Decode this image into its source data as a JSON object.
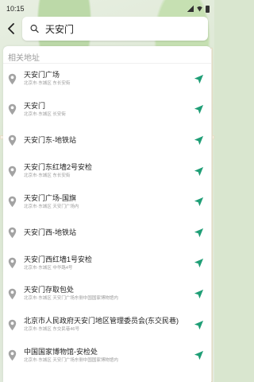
{
  "status_bar": {
    "time": "10:15"
  },
  "search": {
    "query": "天安门"
  },
  "section_title": "相关地址",
  "colors": {
    "accent": "#1f9e76",
    "pin": "#9e9e9e"
  },
  "results": [
    {
      "name": "天安门广场",
      "address": "北京市·东城区 东长安街"
    },
    {
      "name": "天安门",
      "address": "北京市·东城区 长安街"
    },
    {
      "name": "天安门东-地铁站",
      "address": ""
    },
    {
      "name": "天安门东红墙2号安检",
      "address": "北京市·东城区 东长安街"
    },
    {
      "name": "天安门广场-国旗",
      "address": "北京市·东城区 天安门广场内"
    },
    {
      "name": "天安门西-地铁站",
      "address": ""
    },
    {
      "name": "天安门西红墙1号安检",
      "address": "北京市·东城区 中华路4号"
    },
    {
      "name": "天安门存取包处",
      "address": "北京市·东城区 天安门广场东侧中国国家博物馆内"
    },
    {
      "name": "北京市人民政府天安门地区管理委员会(东交民巷)",
      "address": "北京市·东城区 东交民巷46号"
    },
    {
      "name": "中国国家博物馆-安检处",
      "address": "北京市·东城区 天安门广场东侧中国国家博物馆内"
    }
  ]
}
